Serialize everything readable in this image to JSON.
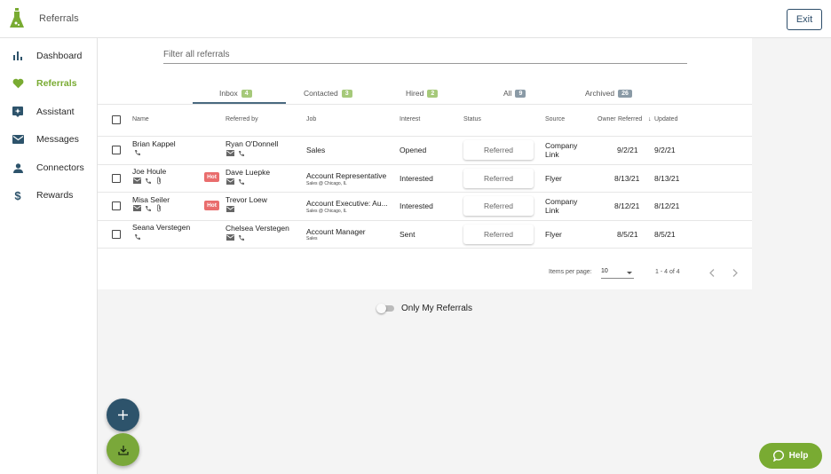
{
  "app": {
    "title": "Referrals",
    "exit_label": "Exit",
    "brand_color": "#79ab32",
    "dark_color": "#2d536b"
  },
  "sidebar": {
    "items": [
      {
        "label": "Dashboard",
        "icon": "bar-chart-icon"
      },
      {
        "label": "Referrals",
        "icon": "heart-icon",
        "active": true
      },
      {
        "label": "Assistant",
        "icon": "assistant-icon"
      },
      {
        "label": "Messages",
        "icon": "mail-icon"
      },
      {
        "label": "Connectors",
        "icon": "person-icon"
      },
      {
        "label": "Rewards",
        "icon": "dollar-icon"
      }
    ]
  },
  "filter": {
    "placeholder": "Filter all referrals"
  },
  "tabs": [
    {
      "label": "Inbox",
      "count": "4",
      "active": true
    },
    {
      "label": "Contacted",
      "count": "3"
    },
    {
      "label": "Hired",
      "count": "2"
    },
    {
      "label": "All",
      "count": "9"
    },
    {
      "label": "Archived",
      "count": "26"
    }
  ],
  "table": {
    "headers": {
      "name": "Name",
      "referred_by": "Referred by",
      "job": "Job",
      "interest": "Interest",
      "status": "Status",
      "source": "Source",
      "owner": "Owner",
      "referred": "Referred",
      "updated": "Updated",
      "sort_arrow": "↓"
    },
    "rows": [
      {
        "name": "Brian Kappel",
        "referred_by": "Ryan O'Donnell",
        "job": "Sales",
        "job_sub": "",
        "interest": "Opened",
        "status": "Referred",
        "source": "Company Link",
        "referred": "9/2/21",
        "updated": "9/2/21",
        "hot": ""
      },
      {
        "name": "Joe Houle",
        "referred_by": "Dave Luepke",
        "job": "Account Representative",
        "job_sub": "Sales @ Chicago, IL",
        "interest": "Interested",
        "status": "Referred",
        "source": "Flyer",
        "referred": "8/13/21",
        "updated": "8/13/21",
        "hot": "Hot"
      },
      {
        "name": "Misa Seiler",
        "referred_by": "Trevor Loew",
        "job": "Account Executive: Au...",
        "job_sub": "Sales @ Chicago, IL",
        "interest": "Interested",
        "status": "Referred",
        "source": "Company Link",
        "referred": "8/12/21",
        "updated": "8/12/21",
        "hot": "Hot"
      },
      {
        "name": "Seana Verstegen",
        "referred_by": "Chelsea Verstegen",
        "job": "Account Manager",
        "job_sub": "Sales",
        "interest": "Sent",
        "status": "Referred",
        "source": "Flyer",
        "referred": "8/5/21",
        "updated": "8/5/21",
        "hot": ""
      }
    ]
  },
  "pagination": {
    "items_per_page_label": "Items per page:",
    "items_per_page": "10",
    "range": "1 - 4 of 4"
  },
  "toggle": {
    "label": "Only My Referrals",
    "on": false
  },
  "help": {
    "label": "Help"
  }
}
